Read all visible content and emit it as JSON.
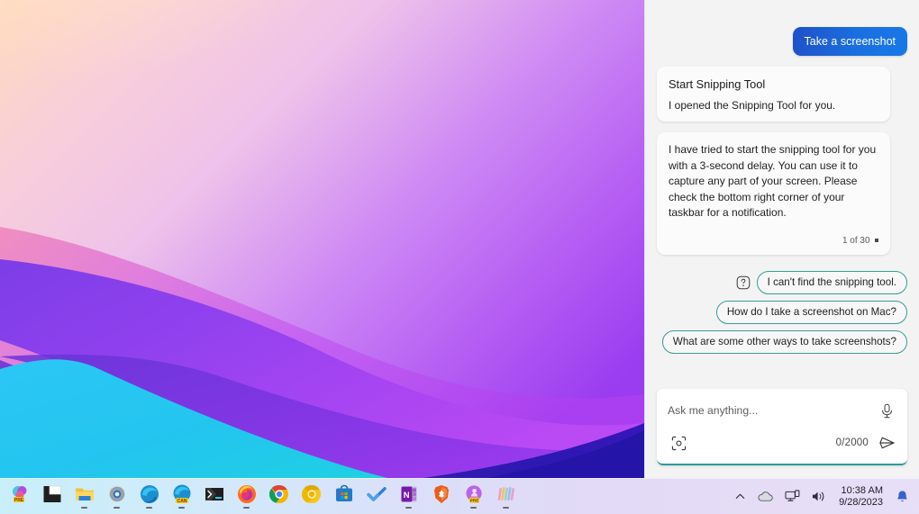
{
  "desktop": {
    "wallpaper_name": "abstract-waves-wallpaper",
    "colors": {
      "peach": "#ffd9c0",
      "pink": "#f0a8d8",
      "magenta": "#c250ee",
      "violet": "#8b30ee",
      "deep_indigo": "#2414a8",
      "cyan": "#29c3ef",
      "teal": "#22d3e8"
    }
  },
  "taskbar": {
    "items": [
      {
        "name": "taskbar-item-prezi",
        "label": "Prezi",
        "running": false
      },
      {
        "name": "taskbar-item-task-view",
        "label": "Task View",
        "running": false
      },
      {
        "name": "taskbar-item-file-explorer",
        "label": "File Explorer",
        "running": true
      },
      {
        "name": "taskbar-item-settings",
        "label": "Settings",
        "running": true
      },
      {
        "name": "taskbar-item-edge",
        "label": "Microsoft Edge",
        "running": true
      },
      {
        "name": "taskbar-item-edge-canary",
        "label": "Edge Canary",
        "running": true
      },
      {
        "name": "taskbar-item-terminal",
        "label": "Windows Terminal",
        "running": false
      },
      {
        "name": "taskbar-item-firefox",
        "label": "Firefox",
        "running": true
      },
      {
        "name": "taskbar-item-chrome",
        "label": "Google Chrome",
        "running": false
      },
      {
        "name": "taskbar-item-chrome-canary",
        "label": "Chrome Canary",
        "running": false
      },
      {
        "name": "taskbar-item-store",
        "label": "Microsoft Store",
        "running": false
      },
      {
        "name": "taskbar-item-todo",
        "label": "Microsoft To Do",
        "running": false
      },
      {
        "name": "taskbar-item-onenote",
        "label": "OneNote",
        "running": true
      },
      {
        "name": "taskbar-item-brave",
        "label": "Brave Browser",
        "running": false
      },
      {
        "name": "taskbar-item-prezi-video",
        "label": "Prezi Video",
        "running": true
      },
      {
        "name": "taskbar-item-clipchamp",
        "label": "Clipchamp",
        "running": true
      }
    ],
    "tray": {
      "chevron_label": "Show hidden icons",
      "weather_label": "Weather",
      "network_label": "Network",
      "volume_label": "Volume",
      "notification_label": "Notifications",
      "clock": {
        "time": "10:38 AM",
        "date": "9/28/2023"
      }
    }
  },
  "copilot": {
    "messages": [
      {
        "role": "user",
        "name": "user-message",
        "text": "Take a screenshot"
      },
      {
        "role": "assistant",
        "name": "plugin-result-card",
        "title": "Start Snipping Tool",
        "subtitle": "I opened the Snipping Tool for you."
      },
      {
        "role": "assistant",
        "name": "assistant-message",
        "text": "I have tried to start the snipping tool for you with a 3-second delay. You can use it to capture any part of your screen. Please check the bottom right corner of your taskbar for a notification.",
        "counter": "1 of 30"
      }
    ],
    "suggestions": [
      {
        "name": "suggestion-chip-1",
        "label": "I can't find the snipping tool."
      },
      {
        "name": "suggestion-chip-2",
        "label": "How do I take a screenshot on Mac?"
      },
      {
        "name": "suggestion-chip-3",
        "label": "What are some other ways to take screenshots?"
      }
    ],
    "composer": {
      "placeholder": "Ask me anything...",
      "value": "",
      "char_count": "0/2000",
      "mic_label": "Use microphone",
      "camera_label": "Add an image",
      "send_label": "Submit"
    },
    "colors": {
      "accent_blue": "#1a6fe0",
      "accent_teal": "#2a9d9b",
      "panel_bg": "#f3f3f3",
      "bubble_bg": "#fbfbfb"
    }
  }
}
